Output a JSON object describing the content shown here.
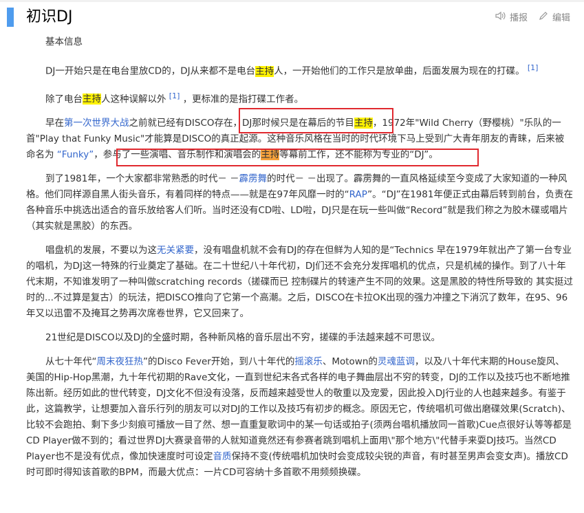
{
  "header": {
    "title": "初识DJ",
    "report_label": "播报",
    "edit_label": "编辑"
  },
  "section_label": "基本信息",
  "paragraphs": {
    "p1": {
      "text": "DJ一开始只是在电台里放CD的，DJ从来都不是电台",
      "hl": "主持",
      "tail": "人，一开始他们的工作只是放单曲，后面发展为现在的打碟。",
      "sup": "[1]"
    },
    "p2": {
      "a": "除了电台",
      "hl": "主持",
      "b": "人这种误解以外",
      "sup": "[1]",
      "c": "，更标准的是指打碟工作者。"
    },
    "p3": {
      "a": "早在",
      "link1": "第一次世界大战",
      "b": "之前就已经有DISCO存在，DJ那时候只是在幕后的节目",
      "hl1": "主持",
      "c": "，1972年\"Wild Cherry（野樱桃）\"乐队的一首\"Play that Funky Music\"才能算是DISCO的真正起源。这种音乐风格在当时的时代环境下马上受到广大青年朋友的青睐，后来被命名为 ",
      "link2": "“Funky”",
      "d": "，参与了一些演唱、音乐制作和演唱会的",
      "hl2": "主持",
      "e": "等幕前工作，还不能称为专业的“DJ”。"
    },
    "p4": {
      "a": "到了1981年，一个大家都非常熟悉的时代－ －",
      "link1": "霹雳舞",
      "b": "的时代－ －出现了。霹雳舞的一直风格延续至今变成了大家知道的一种风格。他们同样源自黑人街头音乐，有着同样的特点——就是在97年风靡一时的“",
      "link2": "RAP",
      "c": "”。“DJ”在1981年便正式由幕后转到前台，负责在各种音乐中挑选出适合的音乐放给客人们听。当时还没有CD啦、LD啦，DJ只是在玩一些叫做“Record”就是我们称之为胶木碟或唱片（其实就是黑胶）的东西。"
    },
    "p5": {
      "a": "唱盘机的发展，不要以为这",
      "link1": "无关紧要",
      "b": "，没有唱盘机就不会有DJ的存在但鲜为人知的是“Technics 早在1979年就出产了第一台专业的唱机，为DJ这一特殊的行业奠定了基础。在二十世纪八十年代初，DJ们还不会充分发挥唱机的优点，只是机械的操作。到了八十年代末期，不知谁发明了一种叫做scratching records（搓碟而已 控制碟片的转速产生不同的效果。这是黑胶的特性所导致的 其实挺过时的...不过算是复古）的玩法，把DISCO推向了它第一个高潮。之后，DISCO在卡拉OK出现的强力冲撞之下消沉了数年，在95、96年又以迅雷不及掩耳之势再次席卷世界，它又回来了。"
    },
    "p6": {
      "text": "21世纪是DISCO以及DJ的全盛时期，各种新风格的音乐层出不穷，搓碟的手法越来越不可思议。"
    },
    "p7": {
      "a": "从七十年代“",
      "link1": "周末夜狂热",
      "b": "”的Disco Fever开始，到八十年代的",
      "link2": "摇滚乐",
      "c": "、Motown的",
      "link3": "灵魂蓝调",
      "d": "，以及八十年代末期的House旋风、美国的Hip-Hop黑潮，九十年代初期的Rave文化，一直到世纪末各式各样的电子舞曲层出不穷的转变，DJ的工作以及技巧也不断地推陈出新。经历如此的世代转变，DJ文化不但没有没落，反而越来越受世人的敬重以及宠爱，因此投入DJ行业的人也越来越多。有鉴于此，这篇教学，让想要加入音乐行列的朋友可以对DJ的工作以及技巧有初步的概念。原因无它，传统唱机可做出磨碟效果(Scratch)、比较不会跑拍、剩下多少刻痕可播放一目了然、想一直重复歌词中的某一句话或拍子(须两台唱机播放同一首歌)Cue点很好认等等都是CD Player做不到的；看过世界DJ大赛录音带的人就知道竟然还有参赛者跳到唱机上面用\\\"那个地方\\\"代替手来耍DJ技巧。当然CD Player也不是没有优点，像加快速度时可设定",
      "link4": "音质",
      "e": "保持不变(传统唱机加快时会变成较尖锐的声音，有时甚至男声会变女声)。播放CD时可即时得知该首歌的BPM，而最大优点：一片CD可容纳十多首歌不用频频换碟。"
    }
  }
}
